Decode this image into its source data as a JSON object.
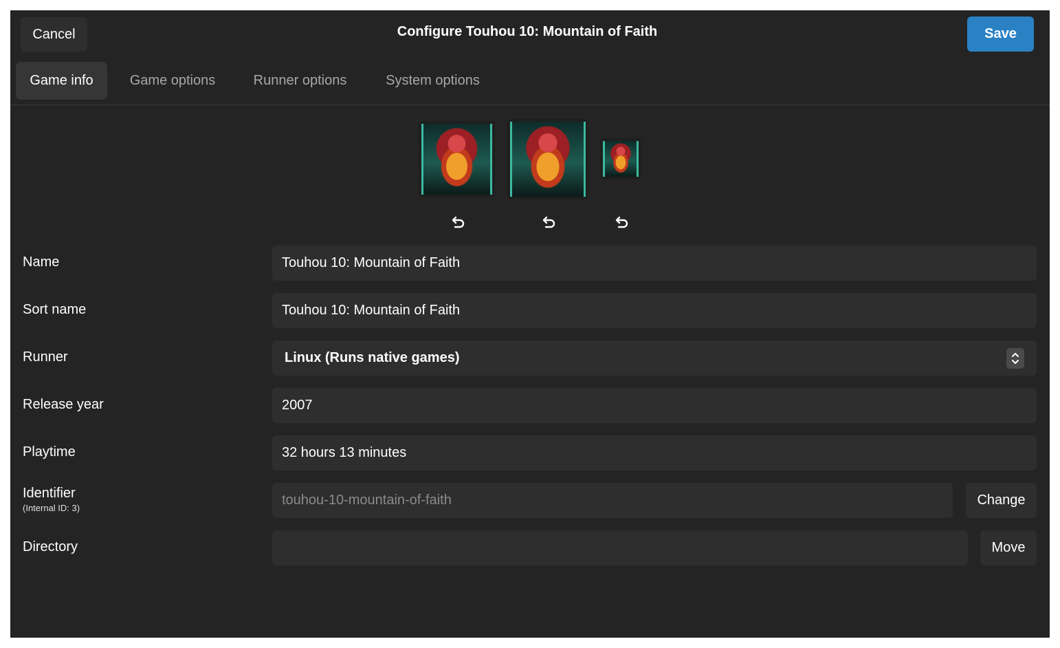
{
  "header": {
    "cancel_label": "Cancel",
    "title": "Configure Touhou 10: Mountain of Faith",
    "save_label": "Save"
  },
  "tabs": [
    {
      "label": "Game info",
      "active": true
    },
    {
      "label": "Game options",
      "active": false
    },
    {
      "label": "Runner options",
      "active": false
    },
    {
      "label": "System options",
      "active": false
    }
  ],
  "covers": [
    {
      "name": "cover-art-1",
      "reset_icon": "undo-icon"
    },
    {
      "name": "cover-art-2",
      "reset_icon": "undo-icon"
    },
    {
      "name": "cover-art-3",
      "reset_icon": "undo-icon"
    }
  ],
  "form": {
    "name": {
      "label": "Name",
      "value": "Touhou 10: Mountain of Faith"
    },
    "sort_name": {
      "label": "Sort name",
      "value": "Touhou 10: Mountain of Faith"
    },
    "runner": {
      "label": "Runner",
      "value": "Linux (Runs native games)",
      "icon": "chevron-up-down-icon"
    },
    "release_year": {
      "label": "Release year",
      "value": "2007"
    },
    "playtime": {
      "label": "Playtime",
      "value": "32 hours 13 minutes"
    },
    "identifier": {
      "label": "Identifier",
      "sublabel": "(Internal ID: 3)",
      "placeholder": "touhou-10-mountain-of-faith",
      "button_label": "Change"
    },
    "directory": {
      "label": "Directory",
      "value": "",
      "button_label": "Move"
    }
  },
  "colors": {
    "window_bg": "#242424",
    "field_bg": "#2e2e2e",
    "accent": "#2a82c4"
  }
}
